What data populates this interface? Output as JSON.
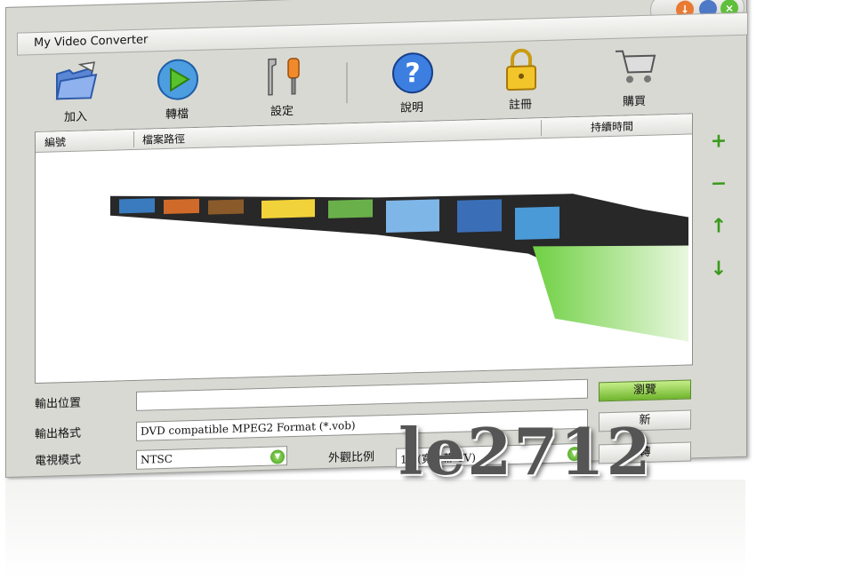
{
  "window": {
    "title": "My Video Converter"
  },
  "toolbar": {
    "add": "加入",
    "convert": "轉檔",
    "settings": "設定",
    "help": "說明",
    "register": "註冊",
    "buy": "購買"
  },
  "list": {
    "col_number": "編號",
    "col_path": "檔案路徑",
    "col_duration": "持續時間"
  },
  "side": {
    "add": "+",
    "remove": "−",
    "up": "↑",
    "down": "↓"
  },
  "form": {
    "output_location_label": "輸出位置",
    "output_location_value": "",
    "browse": "瀏覽",
    "output_format_label": "輸出格式",
    "output_format_value": "DVD compatible MPEG2 Format (*.vob)",
    "tv_mode_label": "電視模式",
    "tv_mode_value": "NTSC",
    "aspect_label": "外觀比例",
    "aspect_value": "16 (寬螢幕 TV)",
    "btn1": "新",
    "btn2": "轉"
  },
  "watermark": "le2712",
  "colors": {
    "accent_green": "#6fb52c",
    "window_bg": "#d8d9d3"
  }
}
